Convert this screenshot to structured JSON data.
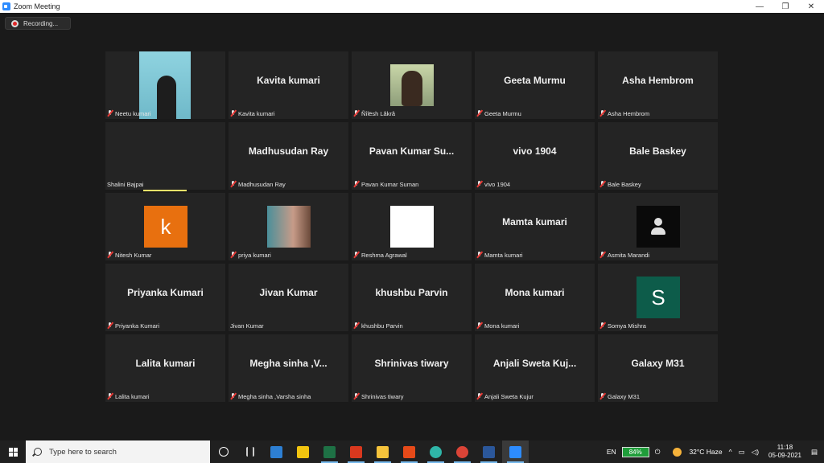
{
  "window": {
    "title": "Zoom Meeting",
    "minimize": "—",
    "restore": "❐",
    "close": "✕"
  },
  "recording": {
    "label": "Recording..."
  },
  "tiles": [
    {
      "big": "",
      "name": "Neetu kumari",
      "kind": "video-neetu"
    },
    {
      "big": "Kavita kumari",
      "name": "Kavita kumari"
    },
    {
      "big": "",
      "name": "Ñîlësh Lâkrâ",
      "kind": "video-nilesh"
    },
    {
      "big": "Geeta Murmu",
      "name": "Geeta Murmu"
    },
    {
      "big": "Asha Hembrom",
      "name": "Asha Hembrom"
    },
    {
      "big": "",
      "name": "Shalini Bajpai",
      "kind": "blank",
      "muted": false
    },
    {
      "big": "Madhusudan Ray",
      "name": "Madhusudan Ray"
    },
    {
      "big": "Pavan Kumar Su...",
      "name": "Pavan Kumar Suman"
    },
    {
      "big": "vivo 1904",
      "name": "vivo 1904"
    },
    {
      "big": "Bale Baskey",
      "name": "Bale Baskey"
    },
    {
      "big": "",
      "name": "Nitesh Kumar",
      "kind": "letter",
      "letter": "k",
      "color": "#e8700f"
    },
    {
      "big": "",
      "name": "priya kumari",
      "kind": "photo-priya"
    },
    {
      "big": "",
      "name": "Reshma Agrawal",
      "kind": "white"
    },
    {
      "big": "Mamta kumari",
      "name": "Mamta kumari"
    },
    {
      "big": "",
      "name": "Asmita Marandi",
      "kind": "person-icon"
    },
    {
      "big": "Priyanka Kumari",
      "name": "Priyanka Kumari"
    },
    {
      "big": "Jivan Kumar",
      "name": "Jivan Kumar",
      "muted": false
    },
    {
      "big": "khushbu Parvin",
      "name": "khushbu Parvin"
    },
    {
      "big": "Mona kumari",
      "name": "Mona kumari"
    },
    {
      "big": "",
      "name": "Somya Mishra",
      "kind": "letter",
      "letter": "S",
      "color": "#0d5c4a"
    },
    {
      "big": "Lalita kumari",
      "name": "Lalita kumari"
    },
    {
      "big": "Megha sinha ,V...",
      "name": "Megha sinha ,Varsha sinha"
    },
    {
      "big": "Shrinivas tiwary",
      "name": "Shrinivas tiwary"
    },
    {
      "big": "Anjali Sweta Kuj...",
      "name": "Anjali Sweta Kujur"
    },
    {
      "big": "Galaxy M31",
      "name": "Galaxy M31"
    }
  ],
  "taskbar": {
    "search_placeholder": "Type here to search",
    "apps": [
      {
        "name": "task-view",
        "color": "#ffffff"
      },
      {
        "name": "widgets",
        "color": "#cccccc"
      },
      {
        "name": "edge-legacy",
        "color": "#2d7fd3"
      },
      {
        "name": "store",
        "color": "#f1c40f"
      },
      {
        "name": "excel",
        "color": "#1e7145"
      },
      {
        "name": "pdf",
        "color": "#d9381e"
      },
      {
        "name": "file-explorer",
        "color": "#f5c33b"
      },
      {
        "name": "office",
        "color": "#e64a19"
      },
      {
        "name": "edge",
        "color": "#2fb5a8"
      },
      {
        "name": "chrome",
        "color": "#db4437"
      },
      {
        "name": "word",
        "color": "#2b579a"
      },
      {
        "name": "zoom",
        "color": "#2d8cff"
      }
    ],
    "lang": "EN",
    "battery": "84%",
    "weather": "32°C  Haze",
    "time": "11:18",
    "date": "05-09-2021"
  }
}
